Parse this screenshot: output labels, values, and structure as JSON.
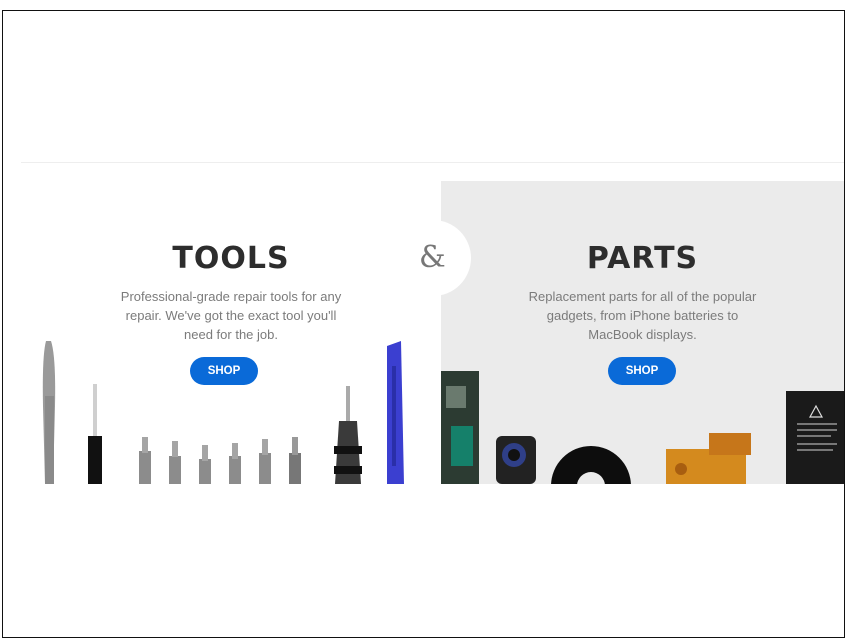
{
  "tools": {
    "title": "TOOLS",
    "description": [
      "Professional-grade repair tools for any",
      "repair. We've got the exact tool you'll",
      "need for the job."
    ],
    "shop_label": "SHOP"
  },
  "separator": "&",
  "parts": {
    "title": "PARTS",
    "description": [
      "Replacement parts for all of the popular",
      "gadgets, from iPhone batteries to",
      "MacBook displays."
    ],
    "shop_label": "SHOP"
  },
  "colors": {
    "accent": "#0a6ad8",
    "parts_bg": "#ebebeb",
    "title": "#2d2d2d",
    "text": "#7b7b7b"
  }
}
